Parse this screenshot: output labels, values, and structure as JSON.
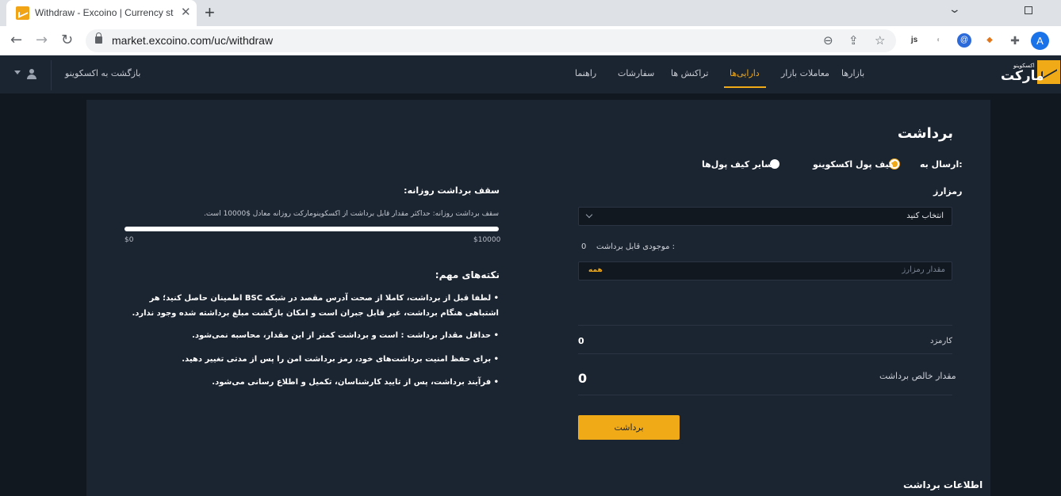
{
  "browser": {
    "tab_title": "Withdraw - Excoino | Currency st",
    "url": "market.excoino.com/uc/withdraw",
    "profile_initial": "A"
  },
  "header": {
    "logo_text": "مارکت",
    "logo_sub": "اکسکوینو",
    "nav": [
      "بازارها",
      "معاملات بازار",
      "دارایی‌ها",
      "تراکنش ها",
      "سفارشات",
      "راهنما"
    ],
    "active_nav": "دارایی‌ها",
    "back_link": "بازگشت به اکسکوینو"
  },
  "form": {
    "title": "برداشت",
    "send_to_label": "ارسال به:",
    "option_excoino_wallet": "کیف پول اکسکوینو",
    "option_other_wallets": "سایر کیف پول‌ها",
    "currency_label": "رمزارز",
    "currency_select": "انتخاب کنید",
    "available_label": "موجودی قابل برداشت :",
    "available_value": "0",
    "amount_placeholder": "مقدار رمزارز",
    "all_button": "همه",
    "fee_label": "کارمزد",
    "fee_value": "0",
    "net_label": "مقدار خالص برداشت",
    "net_value": "0",
    "submit": "برداشت",
    "info_title": "اطلاعات برداشت"
  },
  "daily_limit": {
    "title": "سقف برداشت روزانه:",
    "description": "سقف برداشت روزانه: حداکثر مقدار قابل برداشت از اکسکوینومارکت روزانه معادل $10000 است.",
    "min_label": "$0",
    "max_label": "$10000",
    "used_fraction": 1.0
  },
  "notes": {
    "title": "نکته‌های مهم:",
    "items": [
      "• لطفا قبل از برداشت، کاملا از صحت آدرس مقصد در شبکه BSC اطمینان حاصل کنید؛ هر اشتباهی هنگام برداشت، غیر قابل جبران است و امکان بازگشت مبلغ برداشته شده وجود ندارد.",
      "• حداقل مقدار برداشت  :  است و برداشت کمتر از این مقدار، محاسبه نمی‌شود.",
      "• برای حفظ امنیت برداشت‌های خود، رمز برداشت امن را پس از مدتی تغییر دهید.",
      "• فرآیند برداشت، پس از تایید کارشناسان، تکمیل و اطلاع رسانی می‌شود."
    ]
  },
  "colors": {
    "accent": "#f0a917",
    "panel": "#1b2431",
    "page_bg": "#111820"
  }
}
